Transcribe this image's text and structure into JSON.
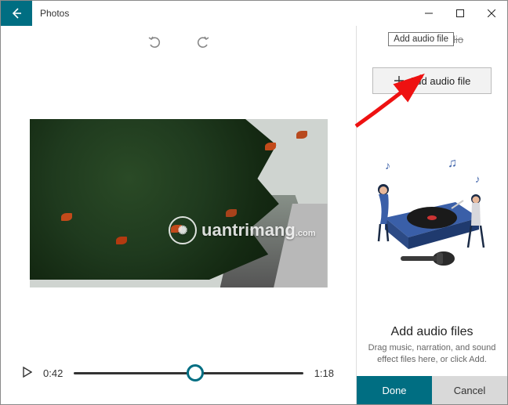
{
  "titlebar": {
    "app_title": "Photos"
  },
  "toolbar": {
    "undo_icon": "undo-icon",
    "redo_icon": "redo-icon"
  },
  "player": {
    "current_time": "0:42",
    "total_time": "1:18",
    "progress_pct": 53
  },
  "watermark": {
    "text": "uantrimang",
    "sub": ".com"
  },
  "side": {
    "section_label": "Custom audio",
    "tooltip": "Add audio file",
    "add_button_label": "Add audio file",
    "empty_heading": "Add audio files",
    "empty_sub": "Drag music, narration, and sound effect files here, or click Add.",
    "done_label": "Done",
    "cancel_label": "Cancel"
  }
}
